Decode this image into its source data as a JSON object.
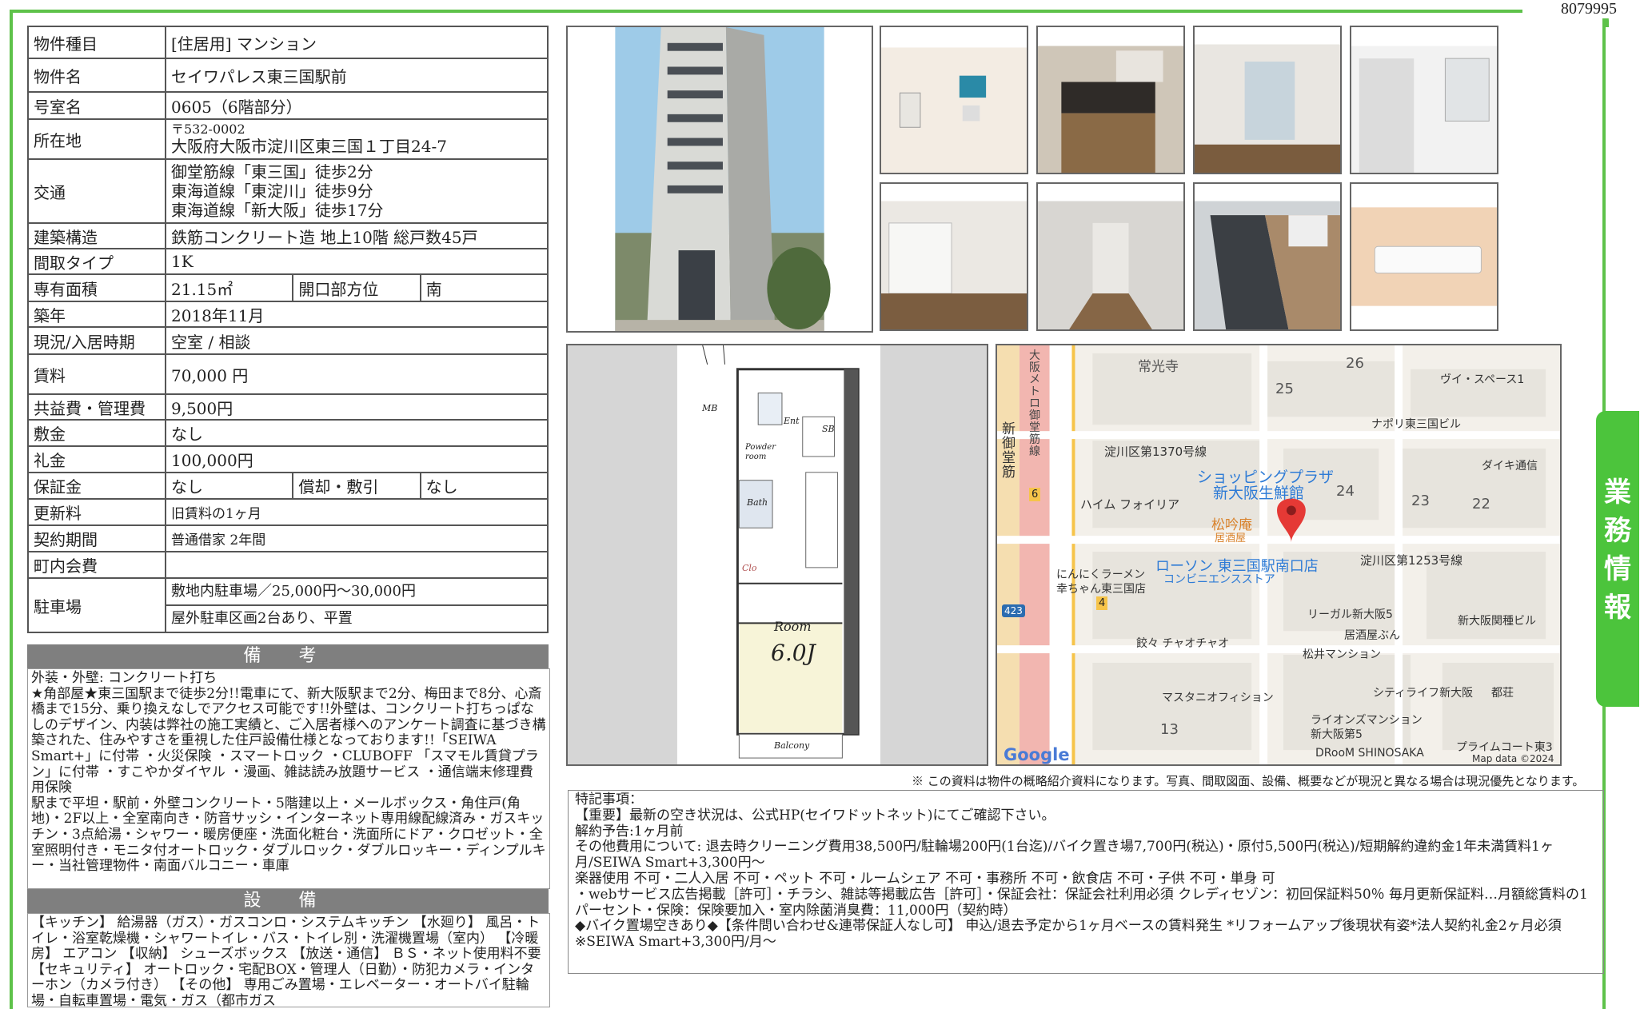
{
  "doc_id": "8079995",
  "property": {
    "type_label": "物件種目",
    "type_value": "[住居用] マンション",
    "name_label": "物件名",
    "name_value": "セイワパレス東三国駅前",
    "room_label": "号室名",
    "room_value": "0605（6階部分）",
    "address_label": "所在地",
    "postal": "〒532-0002",
    "address": "大阪府大阪市淀川区東三国１丁目24-7",
    "access_label": "交通",
    "access": [
      "御堂筋線「東三国」徒歩2分",
      "東海道線「東淀川」徒歩9分",
      "東海道線「新大阪」徒歩17分"
    ],
    "structure_label": "建築構造",
    "structure_value": "鉄筋コンクリート造 地上10階 総戸数45戸",
    "layout_label": "間取タイプ",
    "layout_value": "1K",
    "area_label": "専有面積",
    "area_value": "21.15㎡",
    "direction_label": "開口部方位",
    "direction_value": "南",
    "built_label": "築年",
    "built_value": "2018年11月",
    "status_label": "現況/入居時期",
    "status_value": "空室 / 相談",
    "rent_label": "賃料",
    "rent_value": "70,000 円",
    "fee_label": "共益費・管理費",
    "fee_value": "9,500円",
    "deposit_label": "敷金",
    "deposit_value": "なし",
    "key_money_label": "礼金",
    "key_money_value": "100,000円",
    "guarantee_label": "保証金",
    "guarantee_value": "なし",
    "amort_label": "償却・敷引",
    "amort_value": "なし",
    "renewal_label": "更新料",
    "renewal_value": "旧賃料の1ヶ月",
    "contract_label": "契約期間",
    "contract_value": "普通借家 2年間",
    "community_label": "町内会費",
    "community_value": "",
    "parking_label": "駐車場",
    "parking_values": [
      "敷地内駐車場／25,000円～30,000円",
      "屋外駐車区画2台あり、平置"
    ]
  },
  "remarks": {
    "title": "備 考",
    "text": "外装・外壁: コンクリート打ち\n★角部屋★東三国駅まで徒歩2分!!電車にて、新大阪駅まで2分、梅田まで8分、心斎橋まで15分、乗り換えなしでアクセス可能です!!外壁は、コンクリート打ちっぱなしのデザイン、内装は弊社の施工実績と、ご入居者様へのアンケート調査に基づき構築された、住みやすさを重視した住戸設備仕様となっております!!「SEIWA Smart+」に付帯 ・火災保険 ・スマートロック ・CLUBOFF 「スマモル賃貸プラン」に付帯 ・すこやかダイヤル ・漫画、雑誌読み放題サービス ・通信端末修理費用保険\n駅まで平坦・駅前・外壁コンクリート・5階建以上・メールボックス・角住戸(角地)・2F以上・全室南向き・防音サッシ・インターネット専用線配線済み・ガスキッチン・3点給湯・シャワー・暖房便座・洗面化粧台・洗面所にドア・クロゼット・全室照明付き・モニタ付オートロック・ダブルロック・ダブルロッキー・ディンプルキー・当社管理物件・南面バルコニー・車庫"
  },
  "equipment": {
    "title": "設 備",
    "text": "【キッチン】 給湯器（ガス）・ガスコンロ・システムキッチン 【水廻り】 風呂・トイレ・浴室乾燥機・シャワートイレ・バス・トイレ別・洗濯機置場（室内） 【冷暖房】 エアコン 【収納】 シューズボックス 【放送・通信】 ＢＳ・ネット使用料不要 【セキュリティ】 オートロック・宅配BOX・管理人（日勤）・防犯カメラ・インターホン（カメラ付き） 【その他】 専用ごみ置場・エレベーター・オートバイ駐輪場・自転車置場・電気・ガス（都市ガス"
  },
  "floorplan": {
    "room_label": "Room",
    "room_size": "6.0J",
    "balcony": "Balcony",
    "mb": "MB",
    "ent": "Ent",
    "sb": "SB",
    "powder": "Powder room",
    "bath": "Bath",
    "clo": "Clo"
  },
  "map": {
    "google": "Google",
    "credit": "Map data ©2024",
    "labels": [
      "常光寺",
      "26",
      "25",
      "ヴイ・スペース1",
      "ナポリ東三国ビル",
      "淀川区第1370号線",
      "ダイキ通信",
      "ショッピングプラザ",
      "新大阪生鮮館",
      "24",
      "23",
      "22",
      "ハイム フォイリア",
      "松吟庵",
      "居酒屋",
      "ローソン 東三国駅南口店",
      "コンビニエンスストア",
      "淀川区第1253号線",
      "にんにくラーメン",
      "幸ちゃん東三国店",
      "リーガル新大阪5",
      "新大阪関種ビル",
      "居酒屋ぶん",
      "餃々 チャオチャオ",
      "松井マンション",
      "マスタニオフィション",
      "シティライフ新大阪",
      "都荘",
      "ライオンズマンション",
      "新大阪第5",
      "13",
      "DRooM SHINOSAKA",
      "プライムコート東3",
      "大阪メトロ御堂筋線",
      "新御堂筋",
      "6",
      "4",
      "423"
    ]
  },
  "notice": "※ この資料は物件の概略紹介資料になります。写真、間取図面、設備、概要などが現況と異なる場合は現況優先となります。",
  "special_notes": "特記事項：\n【重要】最新の空き状況は、公式HP(セイワドットネット)にてご確認下さい。\n解約予告:1ヶ月前\nその他費用について: 退去時クリーニング費用38,500円/駐輪場200円(1台迄)/バイク置き場7,700円(税込)・原付5,500円(税込)/短期解約違約金1年未満賃料1ヶ月/SEIWA Smart+3,300円～\n楽器使用 不可・二人入居 不可・ペット 不可・ルームシェア 不可・事務所 不可・飲食店 不可・子供 不可・単身 可\n・webサービス広告掲載［許可］・チラシ、雑誌等掲載広告［許可］・保証会社：保証会社利用必須 クレディセゾン：初回保証料50％ 毎月更新保証料…月額総賃料の1パーセント・保険：保険要加入・室内除菌消臭費：11,000円（契約時）\n◆バイク置場空きあり◆【条件問い合わせ&連帯保証人なし可】 申込/退去予定から1ヶ月ベースの賃料発生 *リフォームアップ後現状有姿*法人契約礼金2ヶ月必須\n※SEIWA Smart+3,300円/月～",
  "side_tab": [
    "業",
    "務",
    "情",
    "報"
  ],
  "colors": {
    "frame": "#5ec24a",
    "section_head": "#7f7f7f",
    "map_pin": "#e53935"
  }
}
